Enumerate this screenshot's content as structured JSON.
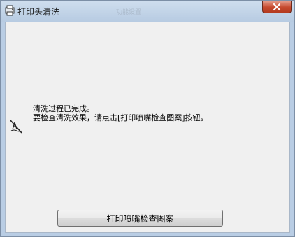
{
  "window": {
    "title": "打印头清洗",
    "ghost_title": "功能设置"
  },
  "message": {
    "line1": "清洗过程已完成。",
    "line2": "要检查清洗效果，请点击[打印喷嘴检查图案]按钮。"
  },
  "buttons": {
    "nozzle_check_label": "打印喷嘴检查图案"
  },
  "icons": {
    "app": "printer-app-icon",
    "status": "nozzle-clean-icon",
    "close": "close-icon"
  }
}
